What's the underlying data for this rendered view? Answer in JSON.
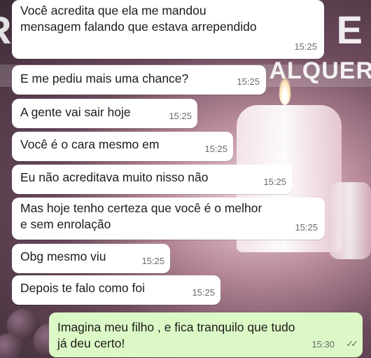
{
  "background": {
    "letters_left": "R",
    "letter_right": "E",
    "word_right": "ALQUER"
  },
  "messages": [
    {
      "direction": "in",
      "lines": [
        "Você acredita que ela me mandou",
        "mensagem falando que estava arrependido"
      ],
      "time": "15:25"
    },
    {
      "direction": "in",
      "lines": [
        "E me pediu mais uma chance?"
      ],
      "time": "15:25"
    },
    {
      "direction": "in",
      "lines": [
        "A gente vai sair hoje"
      ],
      "time": "15:25"
    },
    {
      "direction": "in",
      "lines": [
        "Você é o cara mesmo em"
      ],
      "time": "15:25"
    },
    {
      "direction": "in",
      "lines": [
        "Eu não acreditava muito nisso não"
      ],
      "time": "15:25"
    },
    {
      "direction": "in",
      "lines": [
        "Mas hoje tenho certeza que você é o melhor",
        "e sem enrolação"
      ],
      "time": "15:25"
    },
    {
      "direction": "in",
      "lines": [
        "Obg mesmo viu"
      ],
      "time": "15:25"
    },
    {
      "direction": "in",
      "lines": [
        "Depois te falo como foi"
      ],
      "time": "15:25"
    },
    {
      "direction": "out",
      "lines": [
        "Imagina meu filho , e fica tranquilo que tudo",
        "já deu certo!"
      ],
      "time": "15:30",
      "status": "read"
    }
  ],
  "colors": {
    "incoming_bubble": "#ffffff",
    "outgoing_bubble": "#dcf8c6"
  },
  "icons": {
    "read_receipt": "double-check-icon"
  }
}
